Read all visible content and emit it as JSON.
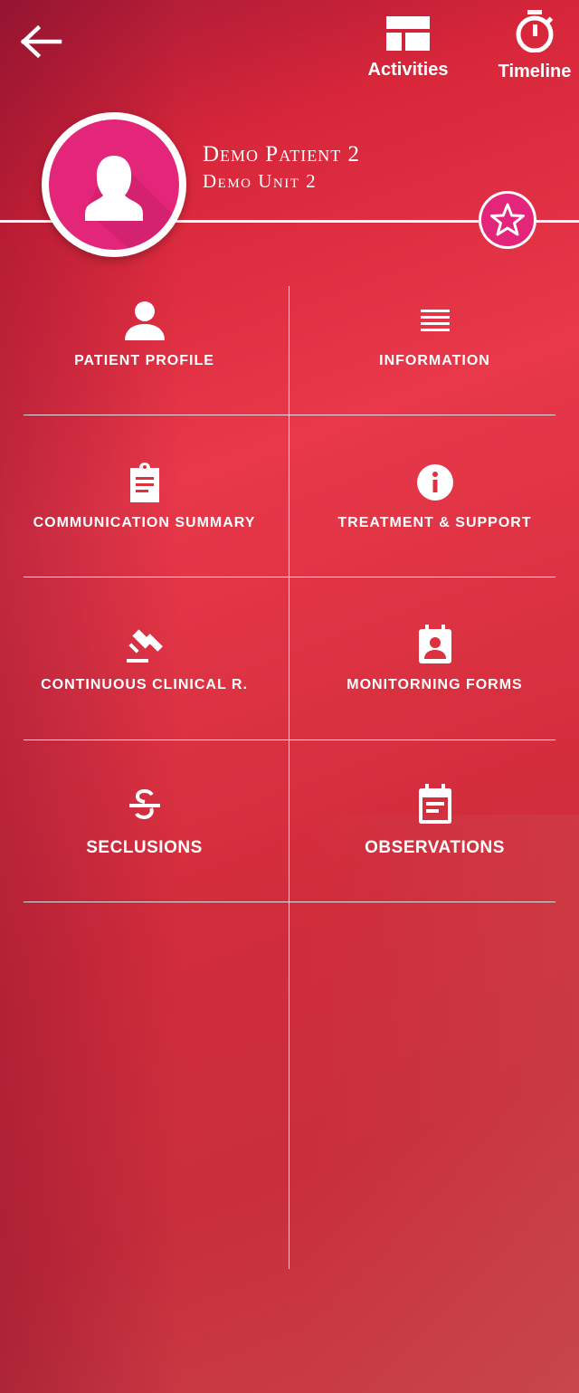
{
  "topbar": {
    "back_icon": "arrow-left-icon",
    "activities_label": "Activities",
    "activities_icon": "dashboard-layout-icon",
    "timeline_label": "Timeline",
    "timeline_icon": "stopwatch-icon"
  },
  "patient": {
    "name": "Demo Patient 2",
    "unit": "Demo Unit 2",
    "avatar_icon": "female-user-icon",
    "favorite_icon": "star-outline-icon",
    "avatar_color": "#e4267a"
  },
  "tiles": [
    {
      "label": "PATIENT PROFILE",
      "icon": "person-icon"
    },
    {
      "label": "INFORMATION",
      "icon": "lines-icon"
    },
    {
      "label": "COMMUNICATION SUMMARY",
      "icon": "clipboard-icon"
    },
    {
      "label": "TREATMENT & SUPPORT",
      "icon": "info-circle-icon"
    },
    {
      "label": "CONTINUOUS CLINICAL R.",
      "icon": "gavel-icon"
    },
    {
      "label": "MONITORNING FORMS",
      "icon": "contact-calendar-icon"
    },
    {
      "label": "SECLUSIONS",
      "icon": "strikethrough-icon"
    },
    {
      "label": "OBSERVATIONS",
      "icon": "calendar-note-icon"
    }
  ],
  "colors": {
    "background_primary": "#e8384a",
    "accent_pink": "#e4267a",
    "text": "#ffffff"
  }
}
